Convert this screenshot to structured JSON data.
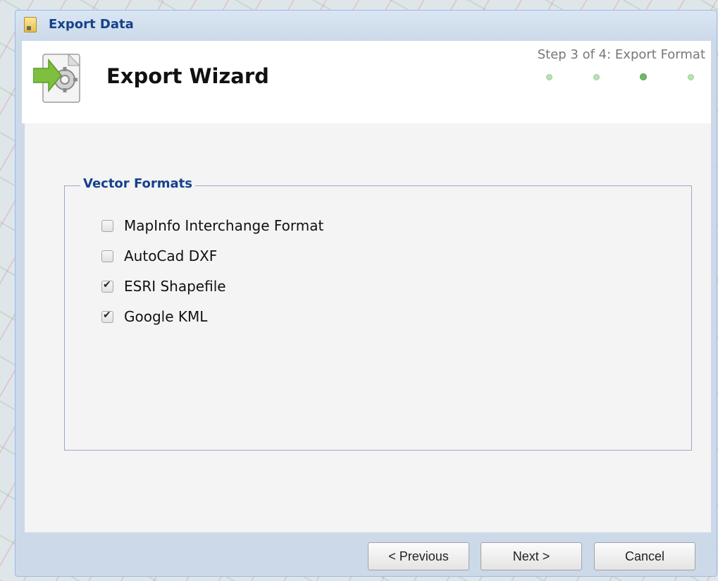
{
  "window": {
    "title": "Export Data",
    "icon": "zip-file-icon"
  },
  "header": {
    "title": "Export Wizard",
    "step_text": "Step 3 of 4: Export Format",
    "total_steps": 4,
    "current_step": 3,
    "icon": "export-gear-icon"
  },
  "fieldset": {
    "legend": "Vector Formats",
    "options": [
      {
        "label": "MapInfo Interchange Format",
        "checked": false
      },
      {
        "label": "AutoCad DXF",
        "checked": false
      },
      {
        "label": "ESRI Shapefile",
        "checked": true
      },
      {
        "label": "Google KML",
        "checked": true
      }
    ]
  },
  "buttons": {
    "previous": "< Previous",
    "next": "Next >",
    "cancel": "Cancel"
  },
  "colors": {
    "title": "#15428b",
    "window_frame": "#ccd9e8",
    "step_dot": "#b9e0b8",
    "step_dot_active": "#6dbb6a"
  }
}
